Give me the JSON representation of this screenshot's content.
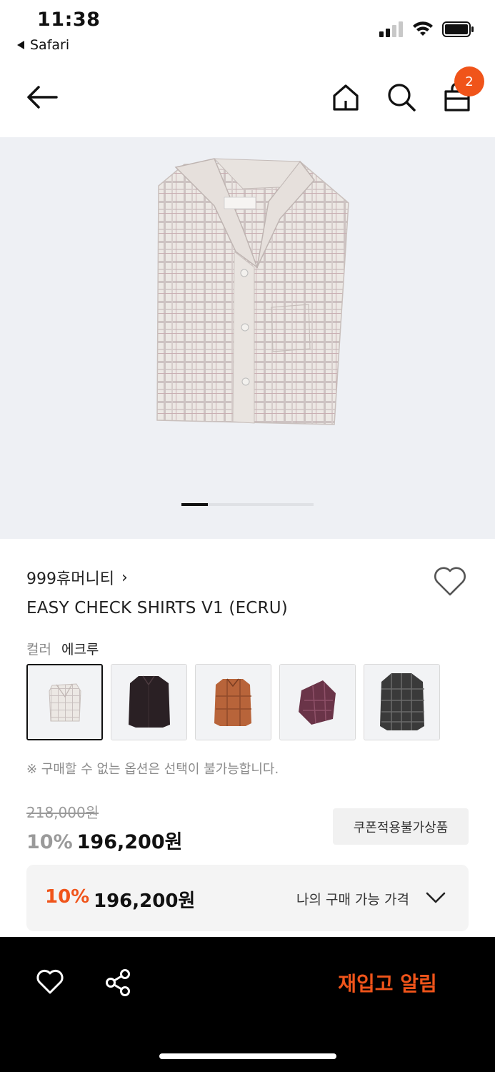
{
  "status_bar": {
    "time": "11:38",
    "back_app": "Safari",
    "icons": [
      "cellular-signal-icon",
      "wifi-icon",
      "battery-icon"
    ]
  },
  "nav": {
    "icons": [
      "arrow-left-icon",
      "home-icon",
      "search-icon",
      "shopping-bag-icon"
    ],
    "cart_count": "2"
  },
  "gallery": {
    "image": "folded plaid shirt photo",
    "page_count": 5,
    "current_page": 1
  },
  "product": {
    "brand": "999휴머니티",
    "brand_chevron": "›",
    "name": "EASY CHECK SHIRTS V1 (ECRU)",
    "color_label": "컬러",
    "color_value": "에크루",
    "swatch_labels": [
      "ecru-check",
      "black-dark",
      "orange-brown",
      "purple-check",
      "black-check"
    ],
    "notice": "※ 구매할 수 없는 옵션은 선택이 불가능합니다."
  },
  "pricing": {
    "original_price": "218,000원",
    "discount_rate": "10%",
    "sale_price": "196,200원",
    "coupon_tag": "쿠폰적용불가상품",
    "my_discount_rate": "10%",
    "my_price": "196,200원",
    "my_price_label": "나의 구매 가능 가격"
  },
  "bottom_bar": {
    "restock_label": "재입고 알림",
    "icons": [
      "heart-icon",
      "share-icon"
    ]
  },
  "colors": {
    "accent": "#f0541a",
    "bottom_bar_bg": "#000000",
    "image_bg": "#eef0f4"
  }
}
